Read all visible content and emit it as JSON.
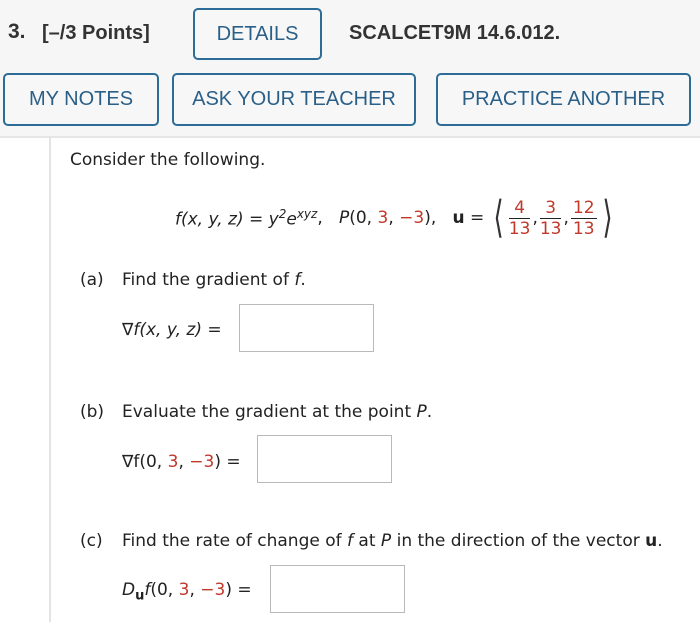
{
  "header": {
    "question_number": "3.",
    "points": "[–/3 Points]",
    "details_button": "DETAILS",
    "problem_code": "SCALCET9M 14.6.012.",
    "my_notes_button": "MY NOTES",
    "ask_teacher_button": "ASK YOUR TEACHER",
    "practice_another_button": "PRACTICE ANOTHER"
  },
  "problem": {
    "intro": "Consider the following.",
    "function_lhs": "f(x, y, z) = y",
    "function_exp_2": "2",
    "function_e": "e",
    "function_exp_xyz": "xyz",
    "point_label": "P(0, ",
    "point_y": "3",
    "point_sep": ", ",
    "point_z": "−3",
    "point_close": "),",
    "vector_label": "u",
    "vector_eq": "=",
    "vector": [
      {
        "num": "4",
        "den": "13"
      },
      {
        "num": "3",
        "den": "13"
      },
      {
        "num": "12",
        "den": "13"
      }
    ]
  },
  "parts": {
    "a": {
      "label": "(a)",
      "prompt_pre": "Find the gradient of ",
      "prompt_var": "f",
      "prompt_post": ".",
      "lhs": "∇f(x, y, z) =",
      "value": ""
    },
    "b": {
      "label": "(b)",
      "prompt_pre": "Evaluate the gradient at the point ",
      "prompt_var": "P",
      "prompt_post": ".",
      "lhs_pre": "∇f(0, ",
      "lhs_y": "3",
      "lhs_sep": ", ",
      "lhs_z": "−3",
      "lhs_post": ") =",
      "value": ""
    },
    "c": {
      "label": "(c)",
      "prompt_pre": "Find the rate of change of ",
      "prompt_f": "f",
      "prompt_mid": " at ",
      "prompt_p": "P",
      "prompt_mid2": " in the direction of the vector ",
      "prompt_u": "u",
      "prompt_post": ".",
      "lhs_D": "D",
      "lhs_sub": "u",
      "lhs_pre": "f(0, ",
      "lhs_y": "3",
      "lhs_sep": ", ",
      "lhs_z": "−3",
      "lhs_post": ") =",
      "value": ""
    }
  },
  "colors": {
    "button_border": "#2d6c96",
    "button_text": "#2a5f88",
    "highlight_red": "#c0392b",
    "header_bg": "#f6f6f6"
  }
}
